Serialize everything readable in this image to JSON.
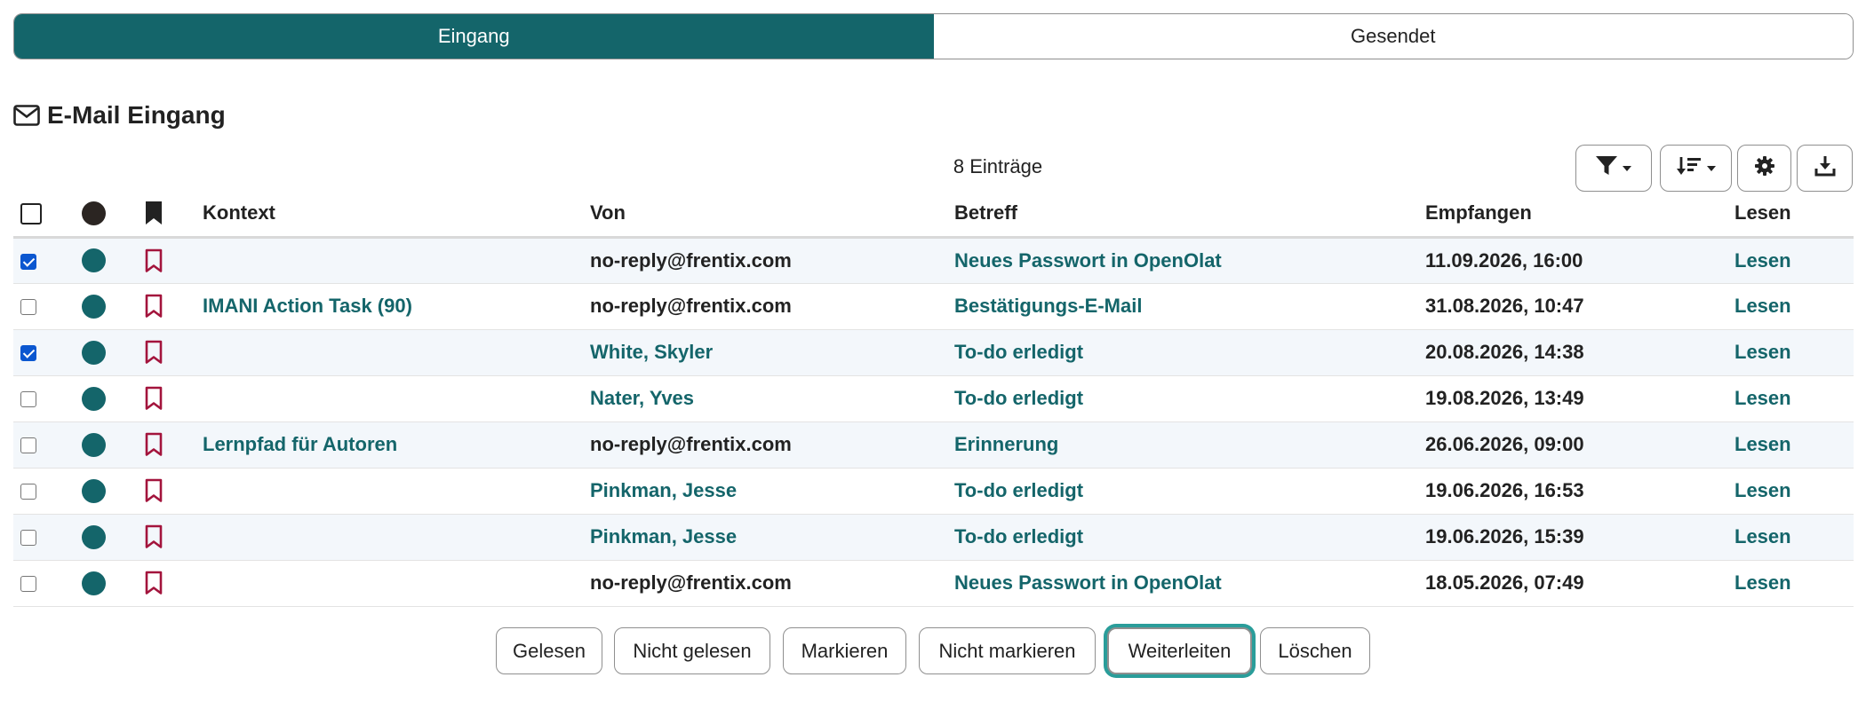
{
  "tabs": [
    {
      "label": "Eingang",
      "active": true
    },
    {
      "label": "Gesendet",
      "active": false
    }
  ],
  "heading": {
    "icon": "envelope-icon",
    "title": "E-Mail Eingang"
  },
  "count_text": "8 Einträge",
  "toolbar": {
    "filter_icon": "filter-icon",
    "sort_icon": "sort-icon",
    "settings_icon": "gear-icon",
    "download_icon": "download-icon"
  },
  "table": {
    "headers": {
      "context": "Kontext",
      "from": "Von",
      "subject": "Betreff",
      "received": "Empfangen",
      "read": "Lesen"
    },
    "rows": [
      {
        "checked": true,
        "context": "",
        "from": "no-reply@frentix.com",
        "from_link": false,
        "subject": "Neues Passwort in OpenOlat",
        "received": "11.09.2026, 16:00",
        "read": "Lesen"
      },
      {
        "checked": false,
        "context": "IMANI Action Task (90)",
        "from": "no-reply@frentix.com",
        "from_link": false,
        "subject": "Bestätigungs-E-Mail",
        "received": "31.08.2026, 10:47",
        "read": "Lesen"
      },
      {
        "checked": true,
        "context": "",
        "from": "White, Skyler",
        "from_link": true,
        "subject": "To-do erledigt",
        "received": "20.08.2026, 14:38",
        "read": "Lesen"
      },
      {
        "checked": false,
        "context": "",
        "from": "Nater, Yves",
        "from_link": true,
        "subject": "To-do erledigt",
        "received": "19.08.2026, 13:49",
        "read": "Lesen"
      },
      {
        "checked": false,
        "context": "Lernpfad für Autoren",
        "from": "no-reply@frentix.com",
        "from_link": false,
        "subject": "Erinnerung",
        "received": "26.06.2026, 09:00",
        "read": "Lesen"
      },
      {
        "checked": false,
        "context": "",
        "from": "Pinkman, Jesse",
        "from_link": true,
        "subject": "To-do erledigt",
        "received": "19.06.2026, 16:53",
        "read": "Lesen"
      },
      {
        "checked": false,
        "context": "",
        "from": "Pinkman, Jesse",
        "from_link": true,
        "subject": "To-do erledigt",
        "received": "19.06.2026, 15:39",
        "read": "Lesen"
      },
      {
        "checked": false,
        "context": "",
        "from": "no-reply@frentix.com",
        "from_link": false,
        "subject": "Neues Passwort in OpenOlat",
        "received": "18.05.2026, 07:49",
        "read": "Lesen"
      }
    ]
  },
  "actions": {
    "read": "Gelesen",
    "unread": "Nicht gelesen",
    "mark": "Markieren",
    "unmark": "Nicht markieren",
    "forward": "Weiterleiten",
    "delete": "Löschen"
  },
  "colors": {
    "accent": "#14656a",
    "bookmark": "#a3143c",
    "focus_ring": "#2a9d9a"
  }
}
